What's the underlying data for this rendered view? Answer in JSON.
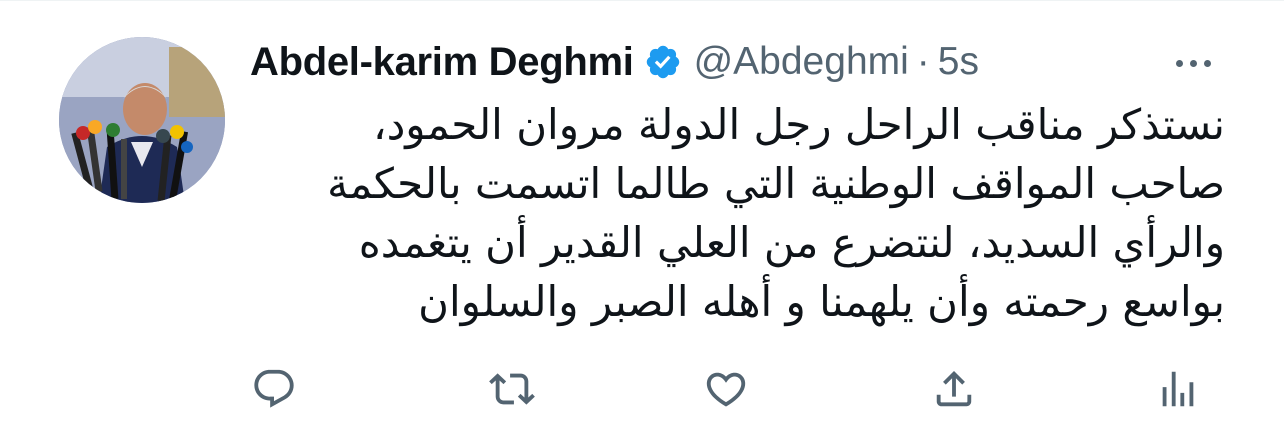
{
  "tweet": {
    "display_name": "Abdel-karim Deghmi",
    "handle": "@Abdeghmi",
    "separator": "·",
    "time": "5s",
    "verified": true,
    "lines": [
      "نستذكر مناقب الراحل رجل الدولة مروان الحمود،",
      "صاحب المواقف الوطنية التي طالما اتسمت بالحكمة",
      "والرأي السديد، لنتضرع من العلي القدير أن يتغمده",
      "بواسع رحمته وأن يلهمنا و أهله الصبر والسلوان"
    ]
  },
  "icons": {
    "avatar": "profile-photo",
    "verified": "verified-badge-icon",
    "more": "more-icon",
    "reply": "reply-icon",
    "retweet": "retweet-icon",
    "like": "like-icon",
    "share": "share-icon",
    "analytics": "analytics-icon"
  },
  "colors": {
    "text_primary": "#0f1419",
    "text_secondary": "#536471",
    "verified_blue": "#1d9bf0"
  }
}
